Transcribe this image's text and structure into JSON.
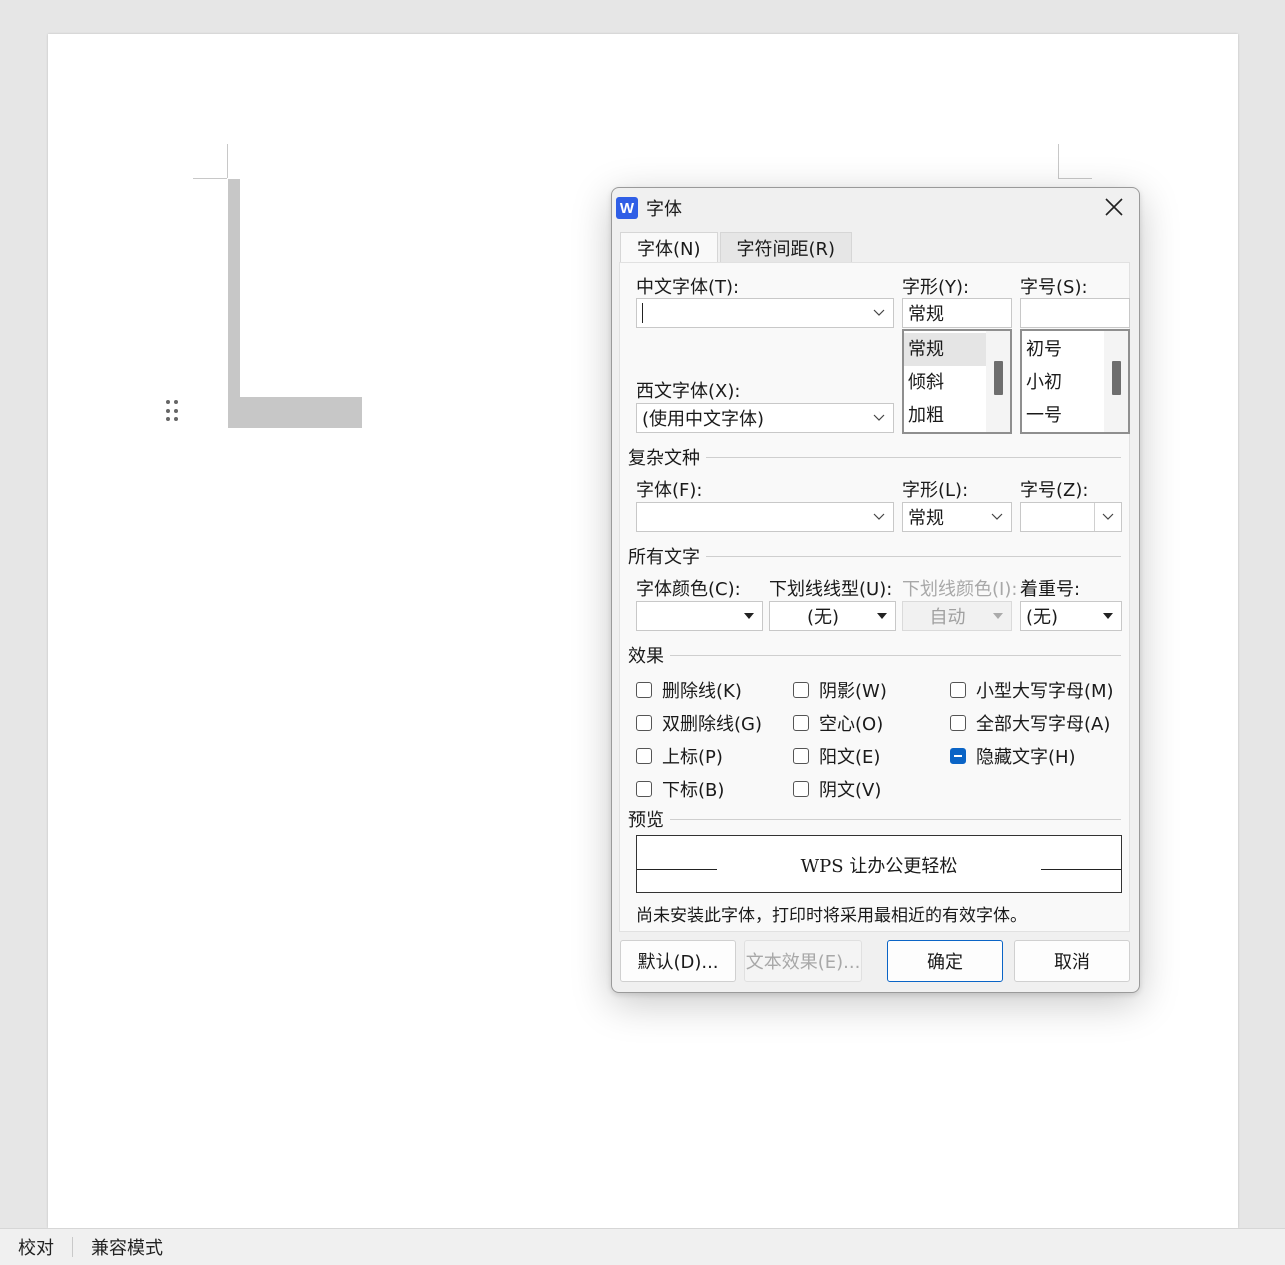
{
  "status_bar": {
    "proofing": "校对",
    "compat_mode": "兼容模式"
  },
  "dialog": {
    "title": "字体",
    "app_icon_letter": "W",
    "tabs": [
      {
        "label": "字体(N)",
        "active": true
      },
      {
        "label": "字符间距(R)",
        "active": false
      }
    ],
    "chinese_font": {
      "label": "中文字体(T):",
      "value": ""
    },
    "western_font": {
      "label": "西文字体(X):",
      "value": "(使用中文字体)"
    },
    "style": {
      "label": "字形(Y):",
      "value": "常规",
      "options": [
        "常规",
        "倾斜",
        "加粗"
      ],
      "selected": "常规"
    },
    "size": {
      "label": "字号(S):",
      "value": "",
      "options": [
        "初号",
        "小初",
        "一号"
      ]
    },
    "complex": {
      "section": "复杂文种",
      "font_label": "字体(F):",
      "font_value": "",
      "style_label": "字形(L):",
      "style_value": "常规",
      "size_label": "字号(Z):",
      "size_value": ""
    },
    "all_text": {
      "section": "所有文字",
      "color_label": "字体颜色(C):",
      "color_value": "",
      "underline_label": "下划线线型(U):",
      "underline_value": "(无)",
      "underline_color_label": "下划线颜色(I):",
      "underline_color_value": "自动",
      "emphasis_label": "着重号:",
      "emphasis_value": "(无)"
    },
    "effects": {
      "section": "效果",
      "items": [
        {
          "label": "删除线(K)",
          "state": "unchecked"
        },
        {
          "label": "双删除线(G)",
          "state": "unchecked"
        },
        {
          "label": "上标(P)",
          "state": "unchecked"
        },
        {
          "label": "下标(B)",
          "state": "unchecked"
        },
        {
          "label": "阴影(W)",
          "state": "unchecked"
        },
        {
          "label": "空心(O)",
          "state": "unchecked"
        },
        {
          "label": "阳文(E)",
          "state": "unchecked"
        },
        {
          "label": "阴文(V)",
          "state": "unchecked"
        },
        {
          "label": "小型大写字母(M)",
          "state": "unchecked"
        },
        {
          "label": "全部大写字母(A)",
          "state": "unchecked"
        },
        {
          "label": "隐藏文字(H)",
          "state": "indeterminate"
        }
      ]
    },
    "preview": {
      "section": "预览",
      "sample": "WPS 让办公更轻松",
      "note": "尚未安装此字体，打印时将采用最相近的有效字体。"
    },
    "buttons": {
      "default": "默认(D)...",
      "text_effects": "文本效果(E)...",
      "ok": "确定",
      "cancel": "取消"
    },
    "accent_color": "#0a64c6"
  }
}
